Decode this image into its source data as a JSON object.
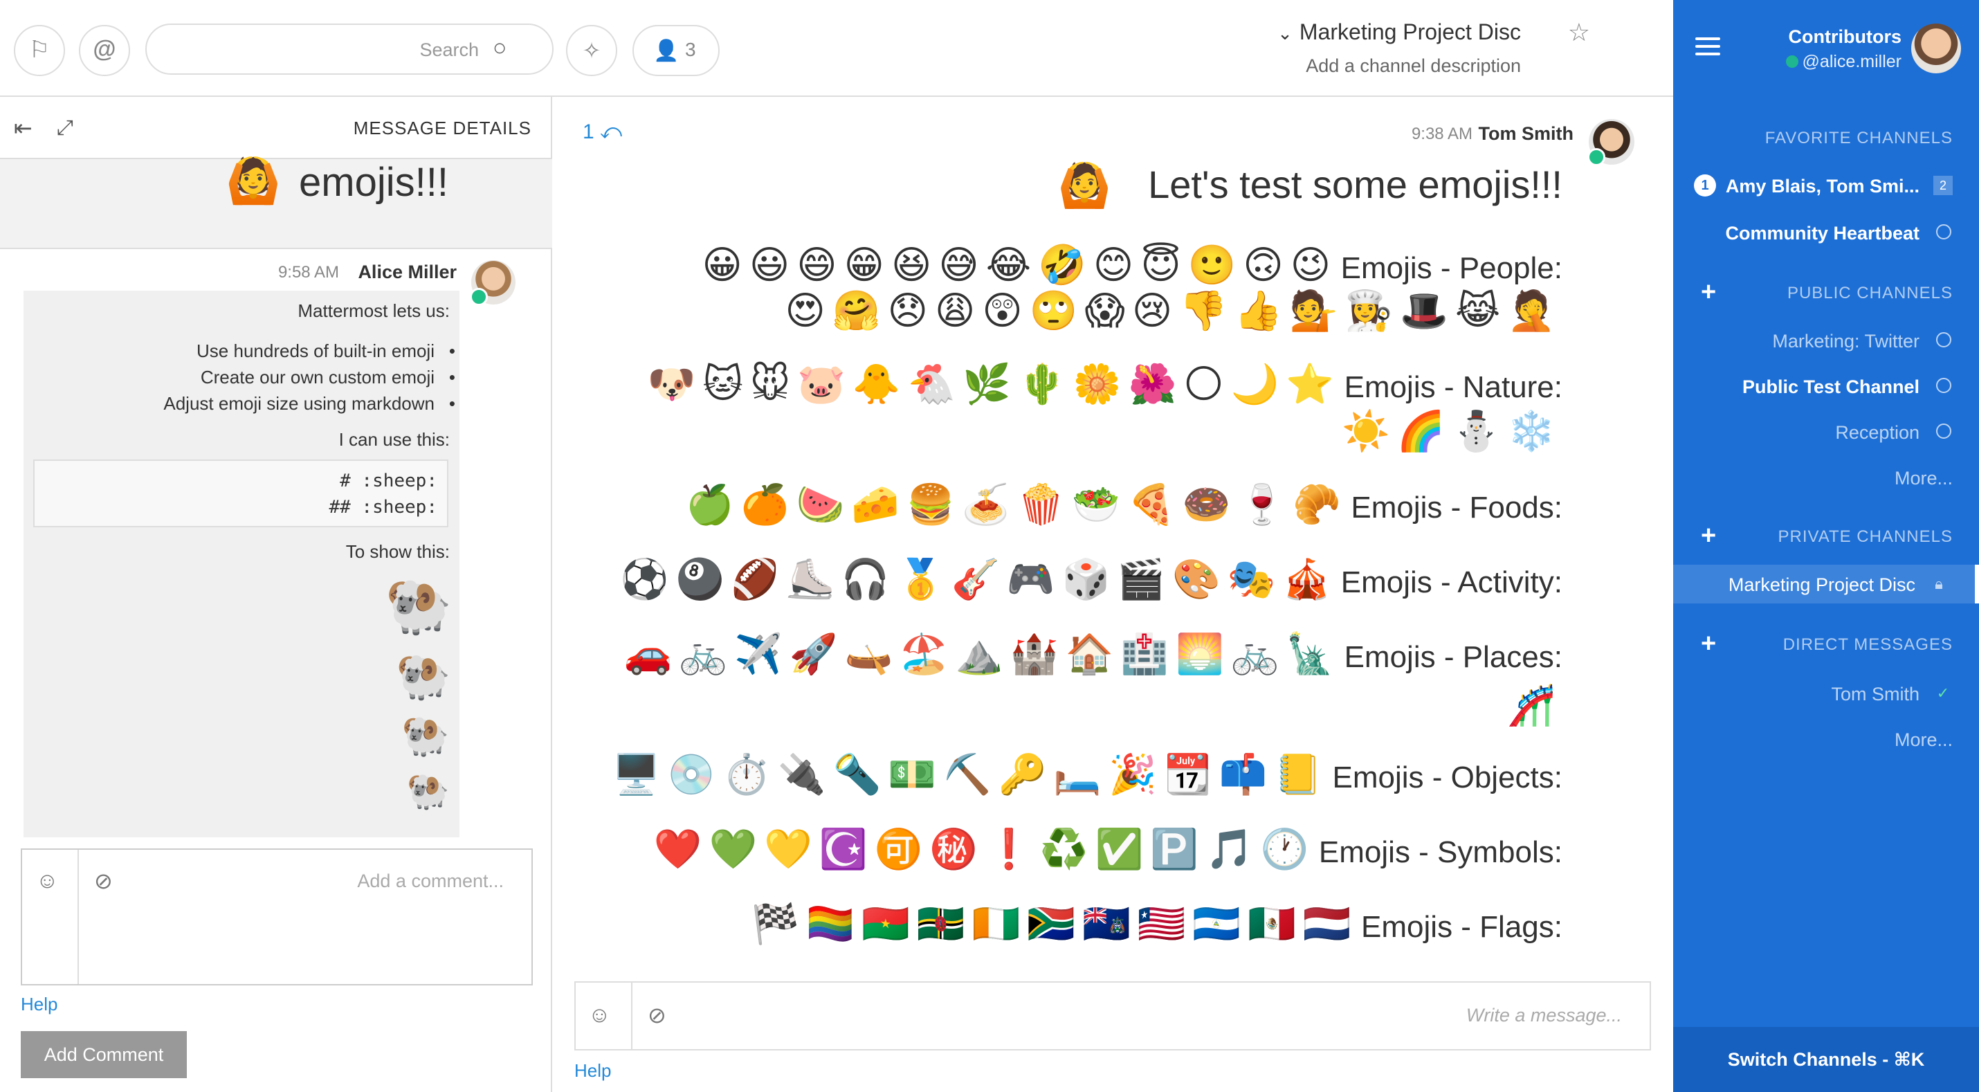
{
  "sidebar": {
    "team_name": "Contributors",
    "username": "@alice.miller",
    "favorite_label": "FAVORITE CHANNELS",
    "favorites": [
      {
        "label": "Amy Blais, Tom Smi...",
        "badge": "1",
        "icon": "group-dm-icon",
        "count_box": "2"
      },
      {
        "label": "Community Heartbeat",
        "icon": "globe-icon"
      }
    ],
    "public_label": "PUBLIC CHANNELS",
    "public": [
      {
        "label": "Marketing: Twitter",
        "icon": "globe-icon"
      },
      {
        "label": "Public Test Channel",
        "icon": "globe-icon"
      },
      {
        "label": "Reception",
        "icon": "globe-icon"
      },
      {
        "label": "More..."
      }
    ],
    "private_label": "PRIVATE CHANNELS",
    "private": [
      {
        "label": "Marketing Project Disc",
        "icon": "lock-icon"
      }
    ],
    "direct_label": "DIRECT MESSAGES",
    "direct": [
      {
        "label": "Tom Smith",
        "icon": "online-status-icon"
      },
      {
        "label": "More..."
      }
    ],
    "switch_label": "Switch Channels - ⌘K",
    "accent": "#1d6fd6"
  },
  "header": {
    "channel_name": "Marketing Project Disc",
    "description": "Add a channel description",
    "member_count": "3",
    "search_placeholder": "Search"
  },
  "post": {
    "author": "Tom Smith",
    "time": "9:38 AM",
    "reply_count": "1",
    "title": "Let's test some emojis!!!",
    "title_emoji": "🙆",
    "rows": [
      {
        "label": "Emojis - People:",
        "line1": "😀😃😄😁😆😅😂🤣😊😇🙂🙃😉",
        "line2": "😍🤗😞😩😲🙄😱😢👎👍💁👩‍🍳🎩😹🤦"
      },
      {
        "label": "Emojis - Nature:",
        "line1": "🐶🐱🐭🐷🐥🐔🌿🌵🌼🌺🌕🌙⭐",
        "line2": "☀️🌈⛄❄️"
      },
      {
        "label": "Emojis - Foods:",
        "line1": "🍏🍊🍉🧀🍔🍝🍿🥗🍕🍩🍷🥐"
      },
      {
        "label": "Emojis - Activity:",
        "line1": "⚽🎱🏈⛸️🎧🥇🎸🎮🎲🎬🎨🎭🎪"
      },
      {
        "label": "Emojis - Places:",
        "line1": "🚗🚲✈️🚀🛶🏖️⛰️🏰🏠🏥🌅🚲🗽",
        "line2": "🎢"
      },
      {
        "label": "Emojis - Objects:",
        "line1": "🖥️💿⏱️🔌🔦💵⛏️🔑🛏️🎉📆📫📒"
      },
      {
        "label": "Emojis - Symbols:",
        "line1": "❤️💚💛☪️🉑㊙️❗♻️✅🅿️🎵🕐"
      },
      {
        "label": "Emojis - Flags:",
        "line1": "🏁🏳️‍🌈🇧🇫🇩🇲🇨🇮🇿🇦🇦🇨🇱🇷🇳🇮🇲🇽🇳🇱"
      }
    ],
    "message_placeholder": "Write a message...",
    "help": "Help"
  },
  "rhs": {
    "title": "MESSAGE DETAILS",
    "root_text": "emojis!!!",
    "root_emoji": "🙆",
    "author": "Alice Miller",
    "time": "9:58 AM",
    "intro": "Mattermost lets us:",
    "bullets": [
      "Use hundreds of built-in emoji",
      "Create our own custom emoji",
      "Adjust emoji size using markdown"
    ],
    "can_use": "I can use this:",
    "code_lines": [
      "# :sheep:",
      "## :sheep:"
    ],
    "to_show": "To show this:",
    "sheep": "🐏",
    "comment_placeholder": "Add a comment...",
    "help": "Help",
    "add_comment": "Add Comment"
  }
}
